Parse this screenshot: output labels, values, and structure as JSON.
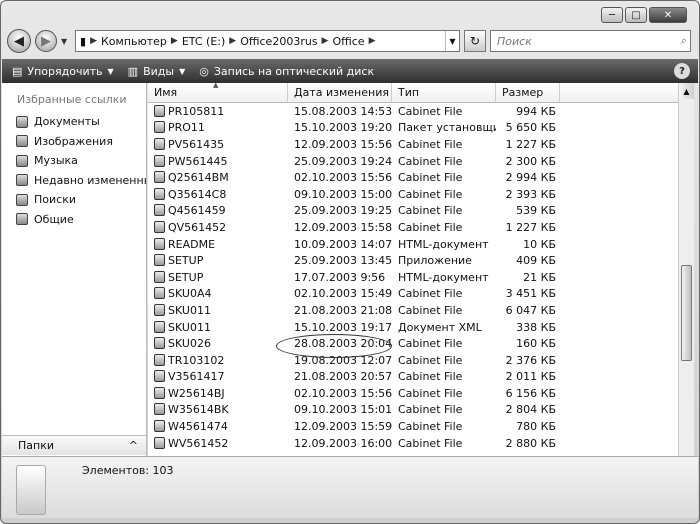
{
  "window": {
    "caption_buttons": [
      "─",
      "□",
      "✕"
    ]
  },
  "address": {
    "crumbs": [
      "Компьютер",
      "ETC (E:)",
      "Office2003rus",
      "Office"
    ],
    "search_placeholder": "Поиск"
  },
  "toolbar": {
    "organize_label": "Упорядочить",
    "views_label": "Виды",
    "burn_label": "Запись на оптический диск"
  },
  "sidebar": {
    "title": "Избранные ссылки",
    "items": [
      {
        "label": "Документы"
      },
      {
        "label": "Изображения"
      },
      {
        "label": "Музыка"
      },
      {
        "label": "Недавно измененные"
      },
      {
        "label": "Поиски"
      },
      {
        "label": "Общие"
      }
    ],
    "folders_label": "Папки"
  },
  "columns": {
    "name": "Имя",
    "date": "Дата изменения",
    "type": "Тип",
    "size": "Размер"
  },
  "files": [
    {
      "name": "PR105811",
      "date": "15.08.2003 14:53",
      "type": "Cabinet File",
      "size": "994 КБ"
    },
    {
      "name": "PRO11",
      "date": "15.10.2003 19:20",
      "type": "Пакет установщи...",
      "size": "5 650 КБ"
    },
    {
      "name": "PV561435",
      "date": "12.09.2003 15:56",
      "type": "Cabinet File",
      "size": "1 227 КБ"
    },
    {
      "name": "PW561445",
      "date": "25.09.2003 19:24",
      "type": "Cabinet File",
      "size": "2 300 КБ"
    },
    {
      "name": "Q25614BM",
      "date": "02.10.2003 15:56",
      "type": "Cabinet File",
      "size": "2 994 КБ"
    },
    {
      "name": "Q35614C8",
      "date": "09.10.2003 15:00",
      "type": "Cabinet File",
      "size": "2 393 КБ"
    },
    {
      "name": "Q4561459",
      "date": "25.09.2003 19:25",
      "type": "Cabinet File",
      "size": "539 КБ"
    },
    {
      "name": "QV561452",
      "date": "12.09.2003 15:58",
      "type": "Cabinet File",
      "size": "1 227 КБ"
    },
    {
      "name": "README",
      "date": "10.09.2003 14:07",
      "type": "HTML-документ",
      "size": "10 КБ"
    },
    {
      "name": "SETUP",
      "date": "25.09.2003 13:45",
      "type": "Приложение",
      "size": "409 КБ"
    },
    {
      "name": "SETUP",
      "date": "17.07.2003 9:56",
      "type": "HTML-документ",
      "size": "21 КБ"
    },
    {
      "name": "SKU0A4",
      "date": "02.10.2003 15:49",
      "type": "Cabinet File",
      "size": "3 451 КБ"
    },
    {
      "name": "SKU011",
      "date": "21.08.2003 21:08",
      "type": "Cabinet File",
      "size": "6 047 КБ"
    },
    {
      "name": "SKU011",
      "date": "15.10.2003 19:17",
      "type": "Документ XML",
      "size": "338 КБ"
    },
    {
      "name": "SKU026",
      "date": "28.08.2003 20:04",
      "type": "Cabinet File",
      "size": "160 КБ"
    },
    {
      "name": "TR103102",
      "date": "19.08.2003 12:07",
      "type": "Cabinet File",
      "size": "2 376 КБ"
    },
    {
      "name": "V3561417",
      "date": "21.08.2003 20:57",
      "type": "Cabinet File",
      "size": "2 011 КБ"
    },
    {
      "name": "W25614BJ",
      "date": "02.10.2003 15:56",
      "type": "Cabinet File",
      "size": "6 156 КБ"
    },
    {
      "name": "W35614BK",
      "date": "09.10.2003 15:01",
      "type": "Cabinet File",
      "size": "2 804 КБ"
    },
    {
      "name": "W4561474",
      "date": "12.09.2003 15:59",
      "type": "Cabinet File",
      "size": "780 КБ"
    },
    {
      "name": "WV561452",
      "date": "12.09.2003 16:00",
      "type": "Cabinet File",
      "size": "2 880 КБ"
    }
  ],
  "status": {
    "items_text": "Элементов: 103"
  }
}
